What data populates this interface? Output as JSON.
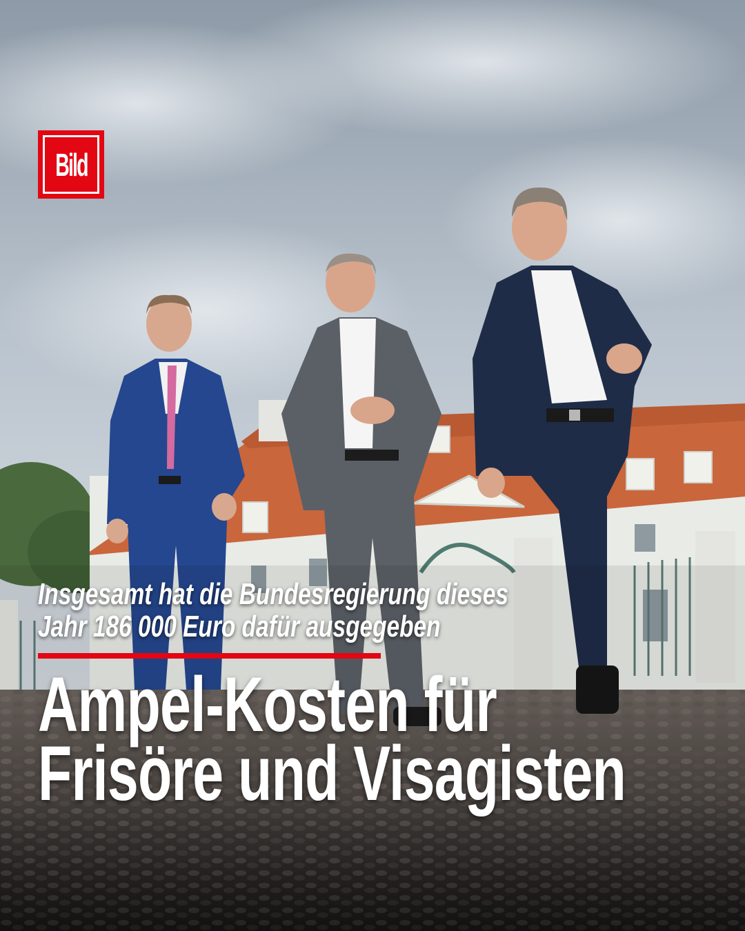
{
  "logo": {
    "text": "Bild",
    "color": "#e30613"
  },
  "subtitle": {
    "lines": [
      "Insgesamt hat die Bundesregierung dieses",
      "Jahr 186 000 Euro dafür ausgegeben"
    ]
  },
  "headline": {
    "lines": [
      "Ampel-Kosten für",
      "Frisöre und Visagisten"
    ]
  },
  "accent_color": "#e30613"
}
